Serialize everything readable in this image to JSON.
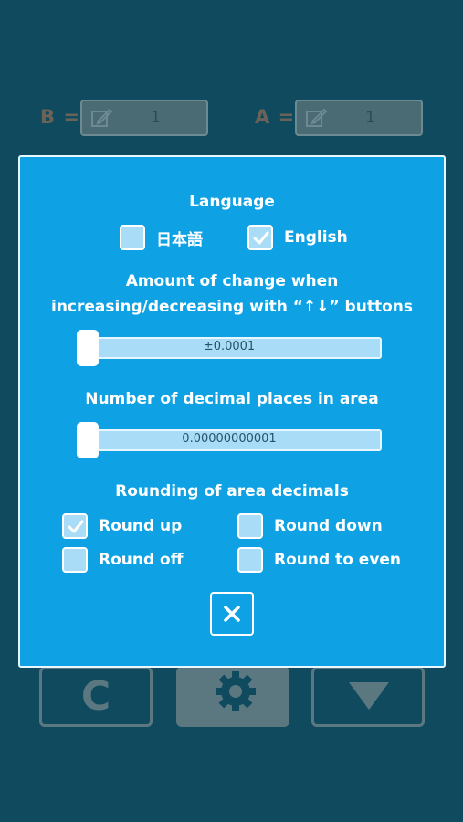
{
  "background": {
    "field_b": {
      "label": "B =",
      "value": "1"
    },
    "field_a": {
      "label": "A =",
      "value": "1"
    },
    "buttons": {
      "clear_label": "C",
      "settings_icon": "gear-icon",
      "down_icon": "triangle-down-icon"
    }
  },
  "dialog": {
    "language": {
      "heading": "Language",
      "options": [
        {
          "label": "日本語",
          "checked": false
        },
        {
          "label": "English",
          "checked": true
        }
      ]
    },
    "step": {
      "heading_line1": "Amount of change when",
      "heading_line2": "increasing/decreasing with “↑↓” buttons",
      "value": "±0.0001",
      "position": 0
    },
    "decimals": {
      "heading": "Number of decimal places in area",
      "value": "0.00000000001",
      "position": 0
    },
    "rounding": {
      "heading": "Rounding of area decimals",
      "options": [
        {
          "label": "Round up",
          "checked": true
        },
        {
          "label": "Round down",
          "checked": false
        },
        {
          "label": "Round off",
          "checked": false
        },
        {
          "label": "Round to even",
          "checked": false
        }
      ]
    },
    "close_icon": "close-icon"
  },
  "colors": {
    "page_bg": "#0f4a5e",
    "dialog_bg": "#0ea1e3",
    "checkbox_fill": "#a9dcf6",
    "text": "#ffffff"
  }
}
